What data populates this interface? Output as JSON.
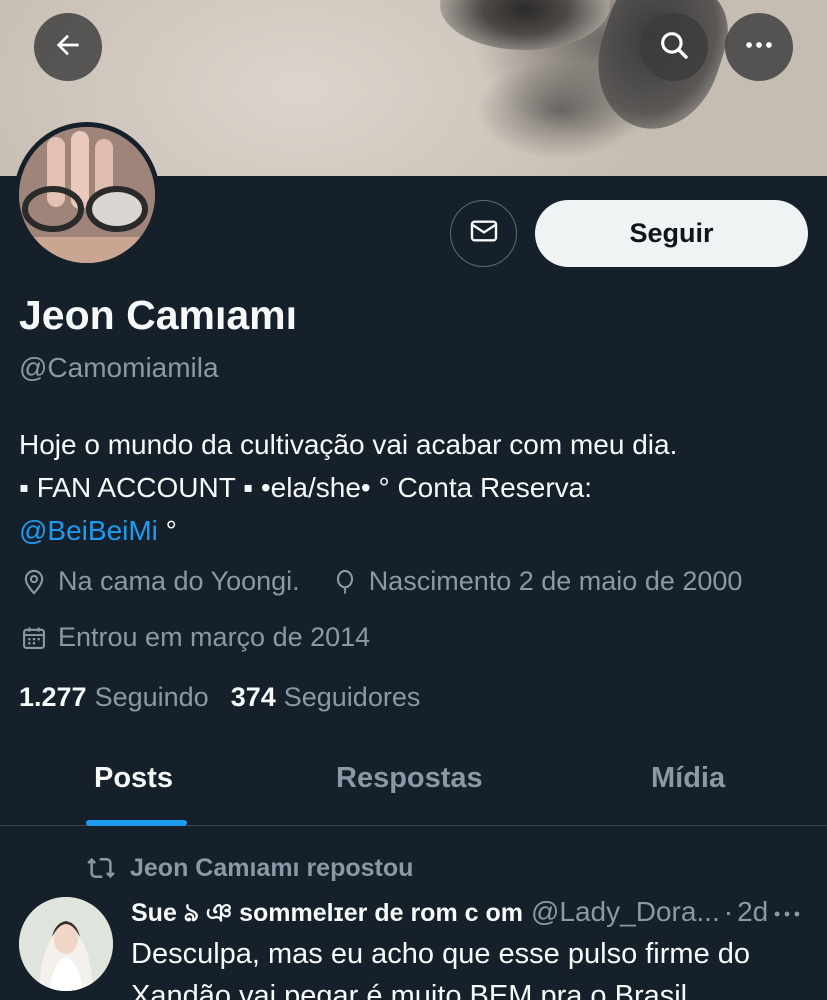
{
  "header": {
    "back_icon": "arrow-left-icon",
    "search_icon": "search-icon",
    "more_icon": "more-horizontal-icon"
  },
  "profile": {
    "display_name": "Jeon Camıamı",
    "handle": "@Camomiamila",
    "bio_line1": "Hoje o mundo da cultivação vai acabar com meu dia.",
    "bio_line2": "▪ FAN ACCOUNT ▪  •ela/she• ° Conta Reserva:",
    "bio_mention": "@BeiBeiMi",
    "bio_suffix": " °",
    "location": "Na cama do Yoongi.",
    "birth": "Nascimento 2 de maio de 2000",
    "joined": "Entrou em março de 2014",
    "following_count": "1.277",
    "following_label": "Seguindo",
    "followers_count": "374",
    "followers_label": "Seguidores"
  },
  "actions": {
    "message_icon": "mail-icon",
    "follow_label": "Seguir"
  },
  "tabs": [
    {
      "label": "Posts",
      "active": true
    },
    {
      "label": "Respostas",
      "active": false
    },
    {
      "label": "Mídia",
      "active": false
    }
  ],
  "feed": {
    "repost_text": "Jeon Camıamı repostou",
    "tweet": {
      "author": "Sue ঌ︎ ঞ sommelɪer de rom c om",
      "handle": "@Lady_Dora...",
      "time": "2d",
      "text": "Desculpa, mas eu acho que esse pulso firme do Xandão vai pegar é muito BEM pra o Brasil"
    }
  },
  "colors": {
    "background": "#15202b",
    "accent": "#1d9bf0",
    "text_primary": "#f7f9f9",
    "text_secondary": "#8b98a5"
  }
}
